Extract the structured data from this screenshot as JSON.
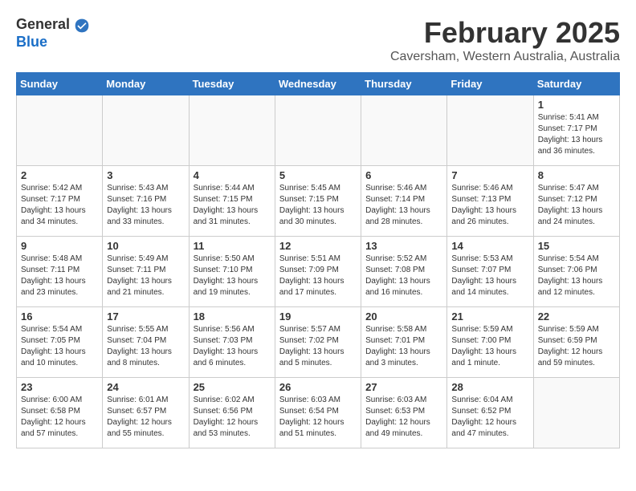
{
  "logo": {
    "general": "General",
    "blue": "Blue"
  },
  "title": "February 2025",
  "subtitle": "Caversham, Western Australia, Australia",
  "weekdays": [
    "Sunday",
    "Monday",
    "Tuesday",
    "Wednesday",
    "Thursday",
    "Friday",
    "Saturday"
  ],
  "weeks": [
    [
      {
        "day": "",
        "info": ""
      },
      {
        "day": "",
        "info": ""
      },
      {
        "day": "",
        "info": ""
      },
      {
        "day": "",
        "info": ""
      },
      {
        "day": "",
        "info": ""
      },
      {
        "day": "",
        "info": ""
      },
      {
        "day": "1",
        "info": "Sunrise: 5:41 AM\nSunset: 7:17 PM\nDaylight: 13 hours\nand 36 minutes."
      }
    ],
    [
      {
        "day": "2",
        "info": "Sunrise: 5:42 AM\nSunset: 7:17 PM\nDaylight: 13 hours\nand 34 minutes."
      },
      {
        "day": "3",
        "info": "Sunrise: 5:43 AM\nSunset: 7:16 PM\nDaylight: 13 hours\nand 33 minutes."
      },
      {
        "day": "4",
        "info": "Sunrise: 5:44 AM\nSunset: 7:15 PM\nDaylight: 13 hours\nand 31 minutes."
      },
      {
        "day": "5",
        "info": "Sunrise: 5:45 AM\nSunset: 7:15 PM\nDaylight: 13 hours\nand 30 minutes."
      },
      {
        "day": "6",
        "info": "Sunrise: 5:46 AM\nSunset: 7:14 PM\nDaylight: 13 hours\nand 28 minutes."
      },
      {
        "day": "7",
        "info": "Sunrise: 5:46 AM\nSunset: 7:13 PM\nDaylight: 13 hours\nand 26 minutes."
      },
      {
        "day": "8",
        "info": "Sunrise: 5:47 AM\nSunset: 7:12 PM\nDaylight: 13 hours\nand 24 minutes."
      }
    ],
    [
      {
        "day": "9",
        "info": "Sunrise: 5:48 AM\nSunset: 7:11 PM\nDaylight: 13 hours\nand 23 minutes."
      },
      {
        "day": "10",
        "info": "Sunrise: 5:49 AM\nSunset: 7:11 PM\nDaylight: 13 hours\nand 21 minutes."
      },
      {
        "day": "11",
        "info": "Sunrise: 5:50 AM\nSunset: 7:10 PM\nDaylight: 13 hours\nand 19 minutes."
      },
      {
        "day": "12",
        "info": "Sunrise: 5:51 AM\nSunset: 7:09 PM\nDaylight: 13 hours\nand 17 minutes."
      },
      {
        "day": "13",
        "info": "Sunrise: 5:52 AM\nSunset: 7:08 PM\nDaylight: 13 hours\nand 16 minutes."
      },
      {
        "day": "14",
        "info": "Sunrise: 5:53 AM\nSunset: 7:07 PM\nDaylight: 13 hours\nand 14 minutes."
      },
      {
        "day": "15",
        "info": "Sunrise: 5:54 AM\nSunset: 7:06 PM\nDaylight: 13 hours\nand 12 minutes."
      }
    ],
    [
      {
        "day": "16",
        "info": "Sunrise: 5:54 AM\nSunset: 7:05 PM\nDaylight: 13 hours\nand 10 minutes."
      },
      {
        "day": "17",
        "info": "Sunrise: 5:55 AM\nSunset: 7:04 PM\nDaylight: 13 hours\nand 8 minutes."
      },
      {
        "day": "18",
        "info": "Sunrise: 5:56 AM\nSunset: 7:03 PM\nDaylight: 13 hours\nand 6 minutes."
      },
      {
        "day": "19",
        "info": "Sunrise: 5:57 AM\nSunset: 7:02 PM\nDaylight: 13 hours\nand 5 minutes."
      },
      {
        "day": "20",
        "info": "Sunrise: 5:58 AM\nSunset: 7:01 PM\nDaylight: 13 hours\nand 3 minutes."
      },
      {
        "day": "21",
        "info": "Sunrise: 5:59 AM\nSunset: 7:00 PM\nDaylight: 13 hours\nand 1 minute."
      },
      {
        "day": "22",
        "info": "Sunrise: 5:59 AM\nSunset: 6:59 PM\nDaylight: 12 hours\nand 59 minutes."
      }
    ],
    [
      {
        "day": "23",
        "info": "Sunrise: 6:00 AM\nSunset: 6:58 PM\nDaylight: 12 hours\nand 57 minutes."
      },
      {
        "day": "24",
        "info": "Sunrise: 6:01 AM\nSunset: 6:57 PM\nDaylight: 12 hours\nand 55 minutes."
      },
      {
        "day": "25",
        "info": "Sunrise: 6:02 AM\nSunset: 6:56 PM\nDaylight: 12 hours\nand 53 minutes."
      },
      {
        "day": "26",
        "info": "Sunrise: 6:03 AM\nSunset: 6:54 PM\nDaylight: 12 hours\nand 51 minutes."
      },
      {
        "day": "27",
        "info": "Sunrise: 6:03 AM\nSunset: 6:53 PM\nDaylight: 12 hours\nand 49 minutes."
      },
      {
        "day": "28",
        "info": "Sunrise: 6:04 AM\nSunset: 6:52 PM\nDaylight: 12 hours\nand 47 minutes."
      },
      {
        "day": "",
        "info": ""
      }
    ]
  ]
}
